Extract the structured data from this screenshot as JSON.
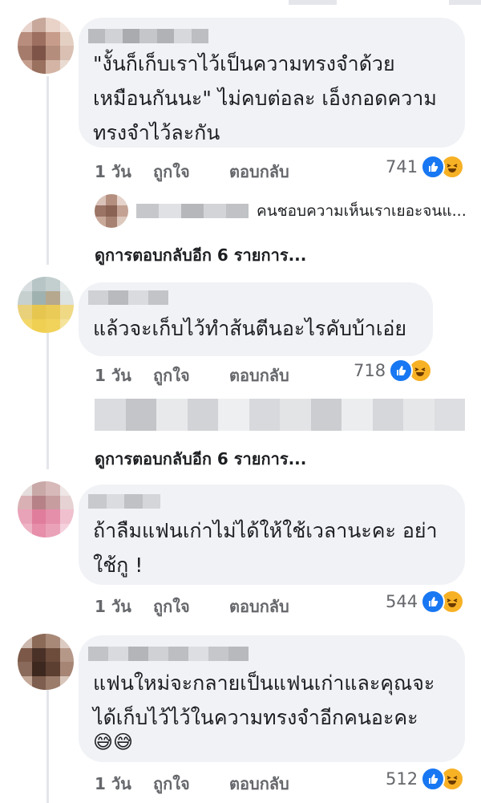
{
  "comments": [
    {
      "text": "\"งั้นก็เก็บเราไว้เป็นความทรงจำด้วย\nเหมือนกันนะ\" ไม่คบต่อละ เอ็งกอดความ\nทรงจำไว้ละกัน",
      "time": "1 วัน",
      "like_label": "ถูกใจ",
      "reply_label": "ตอบกลับ",
      "reaction_count": "741",
      "view_replies": "ดูการตอบกลับอีก 6 รายการ...",
      "reply_preview_text": "คนชอบความเห็นเราเยอะจนแ..."
    },
    {
      "text": "แล้วจะเก็บไว้ทำส้นตีนอะไรคับบ้าเอ่ย",
      "time": "1 วัน",
      "like_label": "ถูกใจ",
      "reply_label": "ตอบกลับ",
      "reaction_count": "718",
      "view_replies": "ดูการตอบกลับอีก 6 รายการ..."
    },
    {
      "text": "ถ้าลืมแฟนเก่าไม่ได้ให้ใช้เวลานะคะ  อย่า\nใช้กู !",
      "time": "1 วัน",
      "like_label": "ถูกใจ",
      "reply_label": "ตอบกลับ",
      "reaction_count": "544"
    },
    {
      "text": "แฟนใหม่จะกลายเป็นแฟนเก่าและคุณจะ\nได้เก็บไว้ไว้ในความทรงจำอีกคนอะคะ",
      "emoji": "😅😅",
      "time": "1 วัน",
      "like_label": "ถูกใจ",
      "reply_label": "ตอบกลับ",
      "reaction_count": "512"
    }
  ],
  "icons": {
    "like": "like-reaction-icon",
    "haha": "haha-reaction-icon"
  },
  "colors": {
    "bubble": "#f0f2f5",
    "like": "#1877f2",
    "haha": "#f7b125",
    "meta": "#65676b"
  }
}
